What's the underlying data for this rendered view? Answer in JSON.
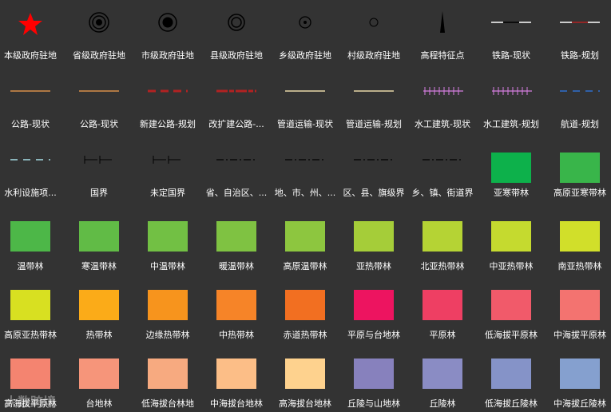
{
  "legend": [
    {
      "label": "本级政府驻地",
      "symbol": "star-icon",
      "color": "#ff0000"
    },
    {
      "label": "省级政府驻地",
      "symbol": "triple-ring-icon",
      "color": "#000000"
    },
    {
      "label": "市级政府驻地",
      "symbol": "ring-dot-large-icon",
      "color": "#000000"
    },
    {
      "label": "县级政府驻地",
      "symbol": "double-ring-icon",
      "color": "#000000"
    },
    {
      "label": "乡级政府驻地",
      "symbol": "ring-dot-small-icon",
      "color": "#000000"
    },
    {
      "label": "村级政府驻地",
      "symbol": "small-circle-icon",
      "color": "#000000"
    },
    {
      "label": "高程特征点",
      "symbol": "spike-icon",
      "color": "#000000"
    },
    {
      "label": "铁路-现状",
      "symbol": "railway-line",
      "color": "#000000"
    },
    {
      "label": "铁路-规划",
      "symbol": "railway-line",
      "color": "#b22222"
    },
    {
      "label": "公路-现状",
      "symbol": "solid-line",
      "color": "#d8904a"
    },
    {
      "label": "公路-现状",
      "symbol": "solid-line",
      "color": "#d8904a"
    },
    {
      "label": "新建公路-规划",
      "symbol": "dashed-thick-line",
      "color": "#b22222"
    },
    {
      "label": "改扩建公路-...",
      "symbol": "dash-dot-thick-line",
      "color": "#b22222"
    },
    {
      "label": "管道运输-现状",
      "symbol": "solid-line",
      "color": "#e8d8a8"
    },
    {
      "label": "管道运输-规划",
      "symbol": "solid-line",
      "color": "#e8d8a8"
    },
    {
      "label": "水工建筑-现状",
      "symbol": "hatched-line",
      "color": "#d67ee0"
    },
    {
      "label": "水工建筑-规划",
      "symbol": "hatched-line",
      "color": "#d67ee0"
    },
    {
      "label": "航道-规划",
      "symbol": "dashed-line",
      "color": "#2f6fd0"
    },
    {
      "label": "水利设施项...",
      "symbol": "dashed-line",
      "color": "#a8e0e8"
    },
    {
      "label": "国界",
      "symbol": "border-line",
      "color": "#000000"
    },
    {
      "label": "未定国界",
      "symbol": "border-line",
      "color": "#000000"
    },
    {
      "label": "省、自治区、...",
      "symbol": "dash-dot-line",
      "color": "#000000"
    },
    {
      "label": "地、市、州、...",
      "symbol": "dash-dot-line",
      "color": "#000000"
    },
    {
      "label": "区、县、旗级界",
      "symbol": "dash-dot-line",
      "color": "#000000"
    },
    {
      "label": "乡、镇、街道界",
      "symbol": "dash-dot-line",
      "color": "#000000"
    },
    {
      "label": "亚寒带林",
      "symbol": "square",
      "color": "#0db14b"
    },
    {
      "label": "高原亚寒带林",
      "symbol": "square",
      "color": "#39b54a"
    },
    {
      "label": "温带林",
      "symbol": "square",
      "color": "#4db748"
    },
    {
      "label": "寒温带林",
      "symbol": "square",
      "color": "#61bb46"
    },
    {
      "label": "中温带林",
      "symbol": "square",
      "color": "#72c044"
    },
    {
      "label": "暖温带林",
      "symbol": "square",
      "color": "#7fc242"
    },
    {
      "label": "高原温带林",
      "symbol": "square",
      "color": "#8dc63f"
    },
    {
      "label": "亚热带林",
      "symbol": "square",
      "color": "#a5cd39"
    },
    {
      "label": "北亚热带林",
      "symbol": "square",
      "color": "#b5d334"
    },
    {
      "label": "中亚热带林",
      "symbol": "square",
      "color": "#c5da2f"
    },
    {
      "label": "南亚热带林",
      "symbol": "square",
      "color": "#d1df2a"
    },
    {
      "label": "高原亚热带林",
      "symbol": "square",
      "color": "#d8e021"
    },
    {
      "label": "热带林",
      "symbol": "square",
      "color": "#fbab18"
    },
    {
      "label": "边缘热带林",
      "symbol": "square",
      "color": "#f7941d"
    },
    {
      "label": "中热带林",
      "symbol": "square",
      "color": "#f68428"
    },
    {
      "label": "赤道热带林",
      "symbol": "square",
      "color": "#f26f21"
    },
    {
      "label": "平原与台地林",
      "symbol": "square",
      "color": "#ed1460"
    },
    {
      "label": "平原林",
      "symbol": "square",
      "color": "#ee3f63"
    },
    {
      "label": "低海拔平原林",
      "symbol": "square",
      "color": "#f15a6a"
    },
    {
      "label": "中海拔平原林",
      "symbol": "square",
      "color": "#f37370"
    },
    {
      "label": "高海拔平原林",
      "symbol": "square",
      "color": "#f48470"
    },
    {
      "label": "台地林",
      "symbol": "square",
      "color": "#f6957a"
    },
    {
      "label": "低海拔台林地",
      "symbol": "square",
      "color": "#f7aa80"
    },
    {
      "label": "中海拔台地林",
      "symbol": "square",
      "color": "#fcbe87"
    },
    {
      "label": "高海拔台地林",
      "symbol": "square",
      "color": "#fed28e"
    },
    {
      "label": "丘陵与山地林",
      "symbol": "square",
      "color": "#8781bd"
    },
    {
      "label": "丘陵林",
      "symbol": "square",
      "color": "#8a8cc4"
    },
    {
      "label": "低海拔丘陵林",
      "symbol": "square",
      "color": "#8593c8"
    },
    {
      "label": "中海拔丘陵林",
      "symbol": "square",
      "color": "#85a0cf"
    }
  ],
  "watermark": "大数跨境"
}
